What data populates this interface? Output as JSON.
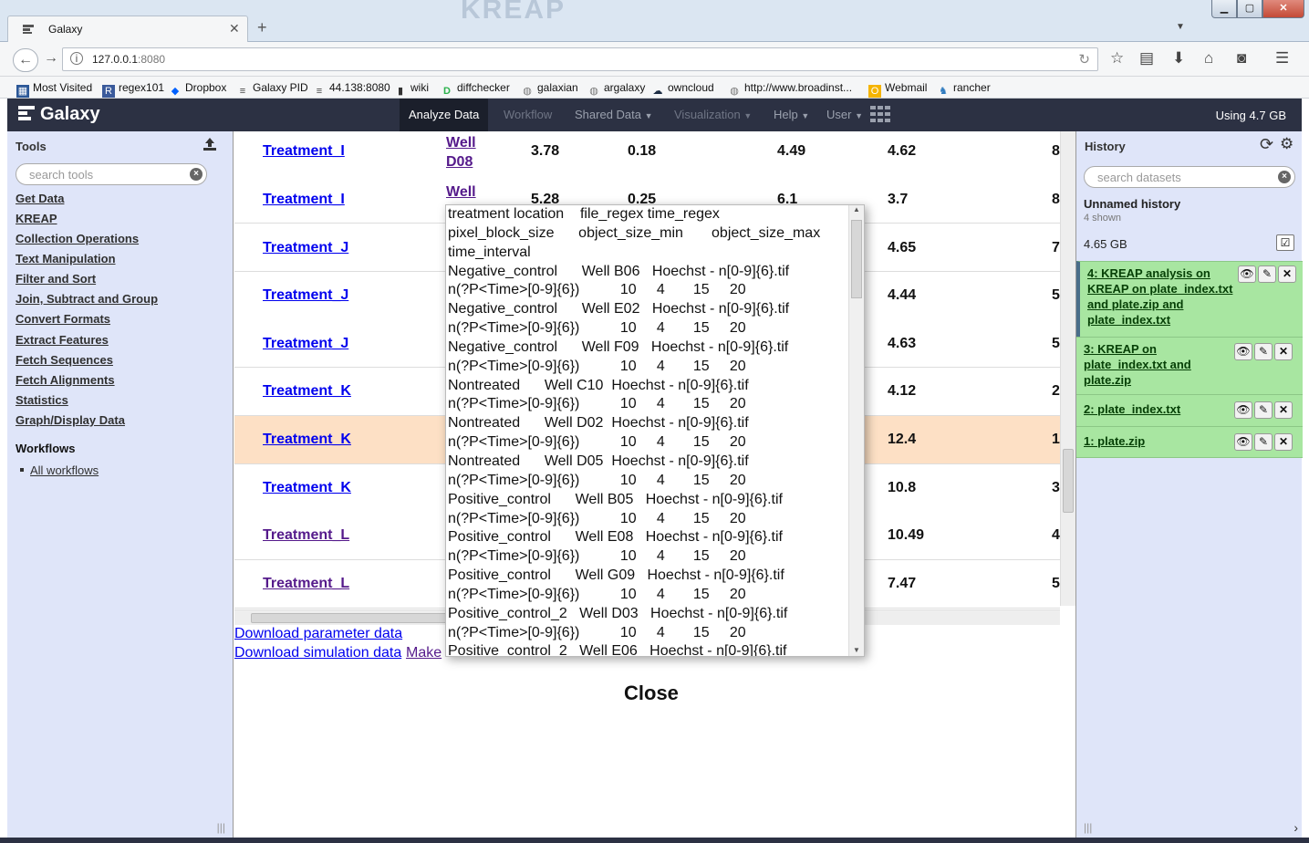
{
  "browser": {
    "tab_title": "Galaxy",
    "window_watermark": "KREAP",
    "url_host": "127.0.0.1",
    "url_port": ":8080",
    "bookmarks": [
      "Most Visited",
      "regex101",
      "Dropbox",
      "Galaxy PID",
      "44.138:8080",
      "wiki",
      "diffchecker",
      "galaxian",
      "argalaxy",
      "owncloud",
      "http://www.broadinst...",
      "Webmail",
      "rancher"
    ]
  },
  "masthead": {
    "brand": "Galaxy",
    "nav": [
      "Analyze Data",
      "Workflow",
      "Shared Data",
      "Visualization",
      "Help",
      "User"
    ],
    "usage": "Using 4.7 GB"
  },
  "tools": {
    "title": "Tools",
    "search_placeholder": "search tools",
    "categories": [
      "Get Data",
      "KREAP",
      "Collection Operations",
      "Text Manipulation",
      "Filter and Sort",
      "Join, Subtract and Group",
      "Convert Formats",
      "Extract Features",
      "Fetch Sequences",
      "Fetch Alignments",
      "Statistics",
      "Graph/Display Data"
    ],
    "workflows_title": "Workflows",
    "all_workflows": "All workflows"
  },
  "table": {
    "rows": [
      {
        "name": "Treatment_I",
        "well1": "Well",
        "well2": "D08",
        "v1": "3.78",
        "v2": "0.18",
        "v3": "4.49",
        "v4": "4.62",
        "v5": "8"
      },
      {
        "name": "Treatment_I",
        "well1": "Well",
        "well2": "",
        "v1": "5.28",
        "v2": "0.25",
        "v3": "6.1",
        "v4": "3.7",
        "v5": "8"
      },
      {
        "name": "Treatment_J",
        "v4": "4.65",
        "v5": "7"
      },
      {
        "name": "Treatment_J",
        "v4": "4.44",
        "v5": "5"
      },
      {
        "name": "Treatment_J",
        "v4": "4.63",
        "v5": "5"
      },
      {
        "name": "Treatment_K",
        "v4": "4.12",
        "v5": "2"
      },
      {
        "name": "Treatment_K",
        "v4": "12.4",
        "v5": "1"
      },
      {
        "name": "Treatment_K",
        "v4": "10.8",
        "v5": "3"
      },
      {
        "name": "Treatment_L",
        "v4": "10.49",
        "v5": "4"
      },
      {
        "name": "Treatment_L",
        "v4": "7.47",
        "v5": "5"
      }
    ],
    "download_param": "Download parameter data",
    "download_sim": "Download simulation data",
    "make_link": "Make",
    "close": "Close"
  },
  "popup": {
    "lines": [
      "treatment location    file_regex time_regex",
      "pixel_block_size      object_size_min       object_size_max",
      "time_interval",
      "Negative_control      Well B06   Hoechst - n[0-9]{6}.tif",
      "n(?P<Time>[0-9]{6})          10     4       15     20",
      "Negative_control      Well E02   Hoechst - n[0-9]{6}.tif",
      "n(?P<Time>[0-9]{6})          10     4       15     20",
      "Negative_control      Well F09   Hoechst - n[0-9]{6}.tif",
      "n(?P<Time>[0-9]{6})          10     4       15     20",
      "Nontreated      Well C10  Hoechst - n[0-9]{6}.tif",
      "n(?P<Time>[0-9]{6})          10     4       15     20",
      "Nontreated      Well D02  Hoechst - n[0-9]{6}.tif",
      "n(?P<Time>[0-9]{6})          10     4       15     20",
      "Nontreated      Well D05  Hoechst - n[0-9]{6}.tif",
      "n(?P<Time>[0-9]{6})          10     4       15     20",
      "Positive_control      Well B05   Hoechst - n[0-9]{6}.tif",
      "n(?P<Time>[0-9]{6})          10     4       15     20",
      "Positive_control      Well E08   Hoechst - n[0-9]{6}.tif",
      "n(?P<Time>[0-9]{6})          10     4       15     20",
      "Positive_control      Well G09   Hoechst - n[0-9]{6}.tif",
      "n(?P<Time>[0-9]{6})          10     4       15     20",
      "Positive_control_2   Well D03   Hoechst - n[0-9]{6}.tif",
      "n(?P<Time>[0-9]{6})          10     4       15     20",
      "Positive_control_2   Well E06   Hoechst - n[0-9]{6}.tif"
    ]
  },
  "history": {
    "title": "History",
    "search_placeholder": "search datasets",
    "name": "Unnamed history",
    "shown": "4 shown",
    "size": "4.65 GB",
    "datasets": [
      "4: KREAP analysis on KREAP on plate_index.txt and plate.zip and plate_index.txt",
      "3: KREAP on plate_index.txt and plate.zip",
      "2: plate_index.txt",
      "1: plate.zip"
    ]
  }
}
